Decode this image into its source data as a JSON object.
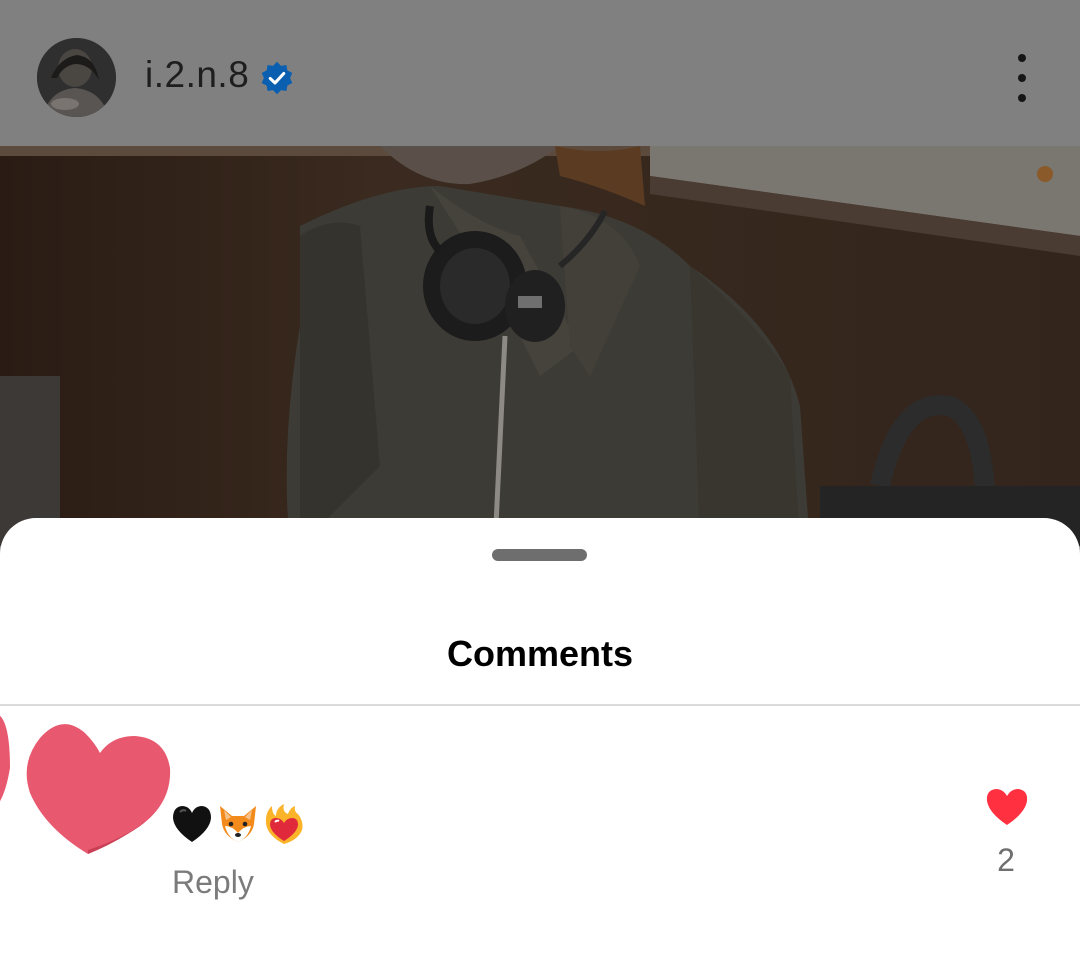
{
  "post_header": {
    "username": "i.2.n.8",
    "avatar_icon": "profile-photo",
    "verified_icon": "verified-badge-icon",
    "more_icon": "more-vertical-icon"
  },
  "photo": {
    "subject": "person-with-headphones-photo"
  },
  "comments_sheet": {
    "title": "Comments",
    "comments": [
      {
        "avatar_icon": "heart-avatar",
        "emojis": [
          "black-heart",
          "fox-face",
          "heart-on-fire"
        ],
        "reply_label": "Reply",
        "like_icon": "heart-icon",
        "like_count": "2"
      }
    ]
  },
  "colors": {
    "verified_blue": "#0a5fb0",
    "like_red": "#ff3040",
    "avatar_pink": "#e8596f",
    "overlay_gray": "#808080"
  }
}
